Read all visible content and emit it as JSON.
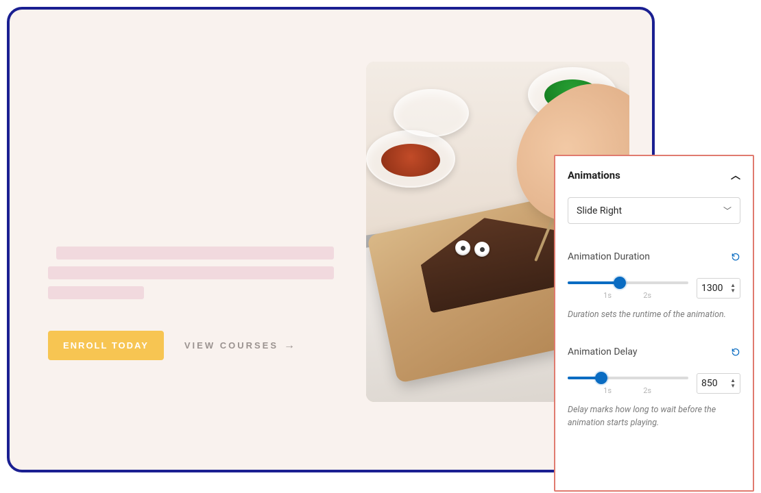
{
  "hero": {
    "primary_cta": "ENROLL TODAY",
    "secondary_cta": "VIEW COURSES"
  },
  "panel": {
    "title": "Animations",
    "select": {
      "value": "Slide Right"
    },
    "duration": {
      "label": "Animation Duration",
      "value": "1300",
      "tick1": "1s",
      "tick2": "2s",
      "help": "Duration sets the runtime of the animation.",
      "fill_percent": 43
    },
    "delay": {
      "label": "Animation Delay",
      "value": "850",
      "tick1": "1s",
      "tick2": "2s",
      "help": "Delay marks how long to wait before the animation starts playing.",
      "fill_percent": 28
    }
  }
}
